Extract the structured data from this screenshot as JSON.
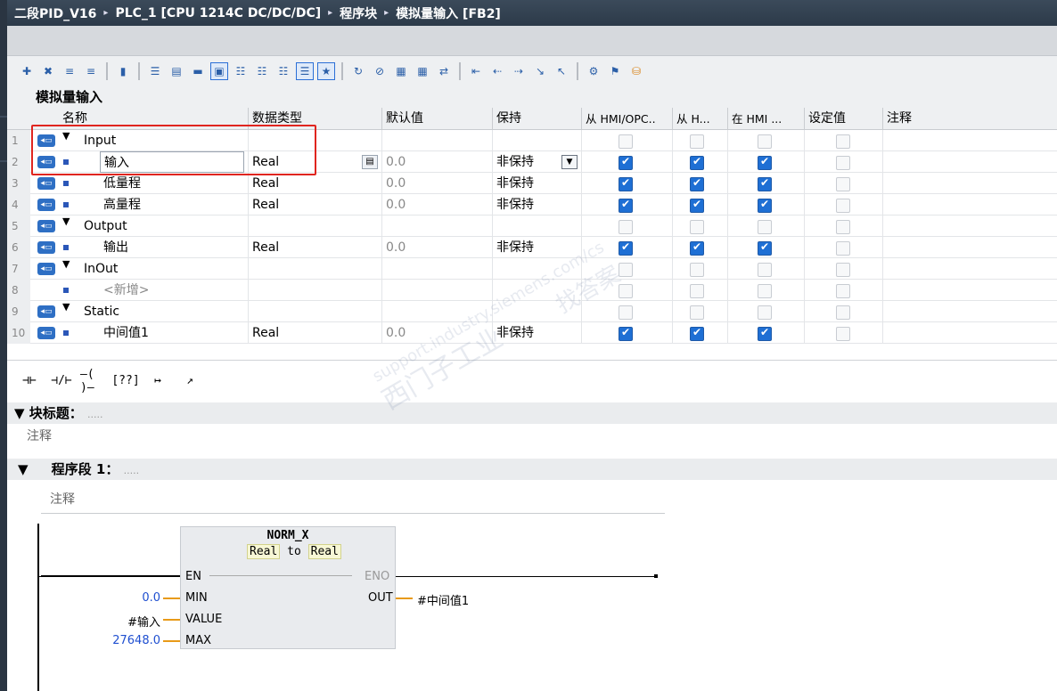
{
  "titlebar": {
    "path": [
      "二段PID_V16",
      "PLC_1 [CPU 1214C DC/DC/DC]",
      "程序块",
      "模拟量输入 [FB2]"
    ],
    "sep": "▸"
  },
  "interface": {
    "block_name": "模拟量输入",
    "columns": [
      "名称",
      "数据类型",
      "默认值",
      "保持",
      "从 HMI/OPC..",
      "从 H...",
      "在 HMI ...",
      "设定值",
      "注释"
    ],
    "rows": [
      {
        "n": "1",
        "name": "Input",
        "type": "",
        "default": "",
        "retain": "",
        "kind": "section"
      },
      {
        "n": "2",
        "name": "输入",
        "type": "Real",
        "default": "0.0",
        "retain": "非保持",
        "kind": "var"
      },
      {
        "n": "3",
        "name": "低量程",
        "type": "Real",
        "default": "0.0",
        "retain": "非保持",
        "kind": "var"
      },
      {
        "n": "4",
        "name": "高量程",
        "type": "Real",
        "default": "0.0",
        "retain": "非保持",
        "kind": "var"
      },
      {
        "n": "5",
        "name": "Output",
        "type": "",
        "default": "",
        "retain": "",
        "kind": "section"
      },
      {
        "n": "6",
        "name": "输出",
        "type": "Real",
        "default": "0.0",
        "retain": "非保持",
        "kind": "var"
      },
      {
        "n": "7",
        "name": "InOut",
        "type": "",
        "default": "",
        "retain": "",
        "kind": "section"
      },
      {
        "n": "8",
        "name": "<新增>",
        "type": "",
        "default": "",
        "retain": "",
        "kind": "add"
      },
      {
        "n": "9",
        "name": "Static",
        "type": "",
        "default": "",
        "retain": "",
        "kind": "section"
      },
      {
        "n": "10",
        "name": "中间值1",
        "type": "Real",
        "default": "0.0",
        "retain": "非保持",
        "kind": "var"
      }
    ]
  },
  "ladder_toolbar": [
    "⊣⊢",
    "⊣/⊢",
    "–( )–",
    "[??]",
    "↦",
    "↗"
  ],
  "block_title": {
    "label": "块标题：",
    "dots": ".....",
    "comment": "注释"
  },
  "network": {
    "label": "程序段 1：",
    "dots": ".....",
    "comment": "注释"
  },
  "fb": {
    "name": "NORM_X",
    "subtitle_from": "Real",
    "subtitle_to": "to",
    "subtitle_type": "Real",
    "en": "EN",
    "eno": "ENO",
    "min": "MIN",
    "value": "VALUE",
    "max": "MAX",
    "out": "OUT",
    "min_val": "0.0",
    "value_val": "#输入",
    "max_val": "27648.0",
    "out_val": "#中间值1"
  },
  "watermark": {
    "line1": "西门子工业",
    "line2": "support.industry.siemens.com/cs",
    "line3": "找答案"
  },
  "colors": {
    "accent": "#1e6fd4",
    "highlight": "#e0251f",
    "value_blue": "#1f4fd0"
  }
}
